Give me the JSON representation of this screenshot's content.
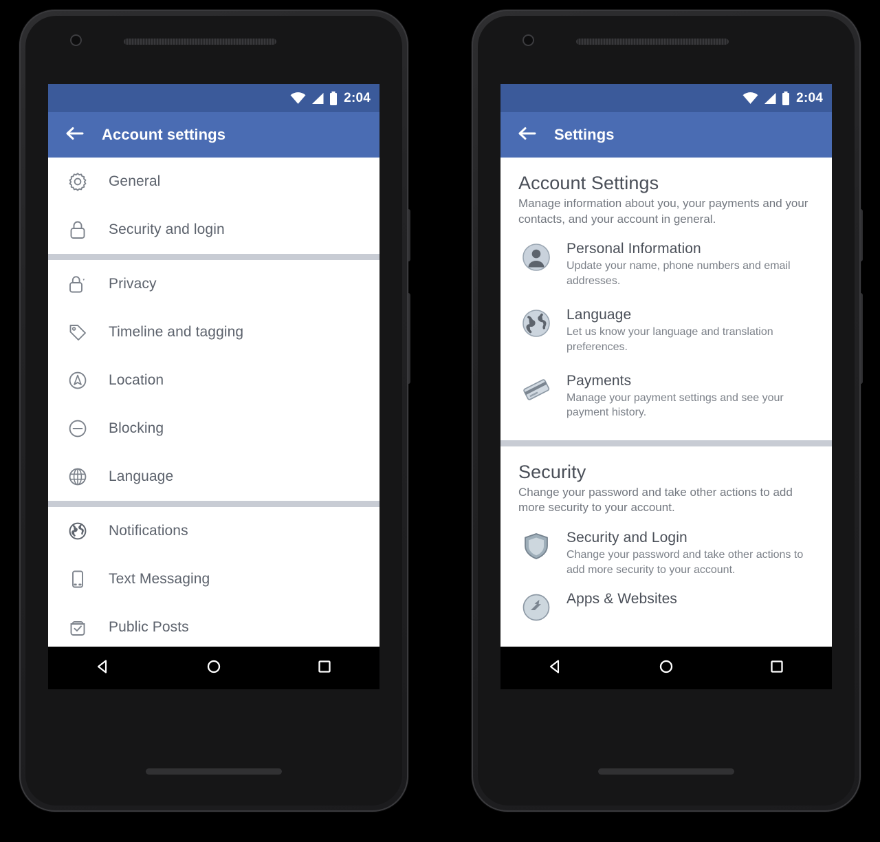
{
  "status_bar": {
    "time": "2:04",
    "icons": [
      "wifi-icon",
      "signal-icon",
      "battery-icon"
    ]
  },
  "colors": {
    "status_bar_blue": "#3b5a9a",
    "app_bar_blue": "#4a6cb3",
    "divider_gray": "#c8ccd4",
    "label_gray": "#5c626c",
    "desc_gray": "#7b8088",
    "screen_white": "#ffffff",
    "nav_black": "#000000"
  },
  "nav_bar": {
    "back_label": "back-button",
    "home_label": "home-button",
    "recents_label": "recents-button"
  },
  "left_phone": {
    "app_bar": {
      "back_icon": "arrow-left-icon",
      "title": "Account settings"
    },
    "groups": [
      {
        "items": [
          {
            "icon": "gear-icon",
            "label": "General"
          },
          {
            "icon": "lock-icon",
            "label": "Security and login"
          }
        ]
      },
      {
        "items": [
          {
            "icon": "lock-caret-icon",
            "label": "Privacy"
          },
          {
            "icon": "tag-icon",
            "label": "Timeline and tagging"
          },
          {
            "icon": "location-icon",
            "label": "Location"
          },
          {
            "icon": "block-icon",
            "label": "Blocking"
          },
          {
            "icon": "globe-outline-icon",
            "label": "Language"
          }
        ]
      },
      {
        "items": [
          {
            "icon": "globe-filled-icon",
            "label": "Notifications"
          },
          {
            "icon": "mobile-phone-icon",
            "label": "Text Messaging"
          },
          {
            "icon": "public-posts-icon",
            "label": "Public Posts"
          }
        ]
      }
    ]
  },
  "right_phone": {
    "app_bar": {
      "back_icon": "arrow-left-icon",
      "title": "Settings"
    },
    "sections": [
      {
        "title": "Account Settings",
        "description": "Manage information about you, your payments and your contacts, and your account in general.",
        "items": [
          {
            "icon": "person-avatar-icon",
            "title": "Personal Information",
            "description": "Update your name, phone numbers and email addresses."
          },
          {
            "icon": "globe-icon",
            "title": "Language",
            "description": "Let us know your language and translation preferences."
          },
          {
            "icon": "credit-card-icon",
            "title": "Payments",
            "description": "Manage your payment settings and see your payment history."
          }
        ]
      },
      {
        "title": "Security",
        "description": "Change your password and take other actions to add more security to your account.",
        "items": [
          {
            "icon": "shield-icon",
            "title": "Security and Login",
            "description": "Change your password and take other actions to add more security to your account."
          },
          {
            "icon": "apps-websites-icon",
            "title": "Apps & Websites",
            "description": ""
          }
        ]
      }
    ]
  }
}
